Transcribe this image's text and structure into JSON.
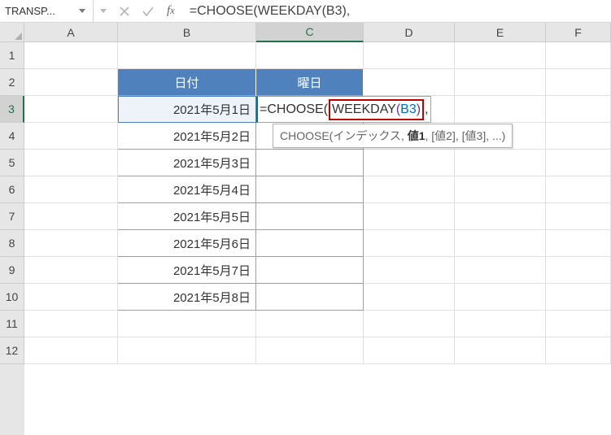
{
  "name_box": "TRANSP...",
  "formula_bar": "=CHOOSE(WEEKDAY(B3),",
  "columns": [
    "A",
    "B",
    "C",
    "D",
    "E",
    "F"
  ],
  "rows": [
    "1",
    "2",
    "3",
    "4",
    "5",
    "6",
    "7",
    "8",
    "9",
    "10",
    "11",
    "12"
  ],
  "active_row": "3",
  "active_col": "C",
  "table": {
    "headers": {
      "date": "日付",
      "weekday": "曜日"
    },
    "dates": [
      "2021年5月1日",
      "2021年5月2日",
      "2021年5月3日",
      "2021年5月4日",
      "2021年5月5日",
      "2021年5月6日",
      "2021年5月7日",
      "2021年5月8日"
    ]
  },
  "editing": {
    "prefix": "=",
    "fn1": "CHOOSE",
    "p1": "(",
    "fn2": "WEEKDAY",
    "p2": "(",
    "ref": "B3",
    "p3": ")",
    "suffix": ","
  },
  "tooltip": {
    "fn": "CHOOSE(",
    "arg_idx": "インデックス",
    "sep1": ", ",
    "arg1": "値1",
    "rest": ", [値2], [値3], ...)"
  }
}
